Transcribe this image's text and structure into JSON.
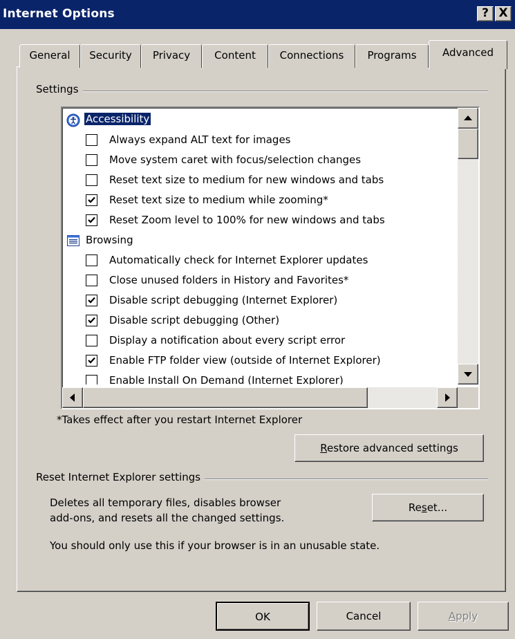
{
  "window": {
    "title": "Internet Options",
    "help_glyph": "?",
    "close_glyph": "X"
  },
  "tabs": [
    {
      "label": "General",
      "active": false
    },
    {
      "label": "Security",
      "active": false
    },
    {
      "label": "Privacy",
      "active": false
    },
    {
      "label": "Content",
      "active": false
    },
    {
      "label": "Connections",
      "active": false
    },
    {
      "label": "Programs",
      "active": false
    },
    {
      "label": "Advanced",
      "active": true
    }
  ],
  "settings": {
    "group_label": "Settings",
    "tree": [
      {
        "type": "header",
        "label": "Accessibility",
        "icon": "accessibility-icon",
        "selected": true
      },
      {
        "type": "checkbox",
        "label": "Always expand ALT text for images",
        "checked": false
      },
      {
        "type": "checkbox",
        "label": "Move system caret with focus/selection changes",
        "checked": false
      },
      {
        "type": "checkbox",
        "label": "Reset text size to medium for new windows and tabs",
        "checked": false
      },
      {
        "type": "checkbox",
        "label": "Reset text size to medium while zooming*",
        "checked": true
      },
      {
        "type": "checkbox",
        "label": "Reset Zoom level to 100% for new windows and tabs",
        "checked": true
      },
      {
        "type": "header",
        "label": "Browsing",
        "icon": "browsing-page-icon",
        "selected": false
      },
      {
        "type": "checkbox",
        "label": "Automatically check for Internet Explorer updates",
        "checked": false
      },
      {
        "type": "checkbox",
        "label": "Close unused folders in History and Favorites*",
        "checked": false
      },
      {
        "type": "checkbox",
        "label": "Disable script debugging (Internet Explorer)",
        "checked": true
      },
      {
        "type": "checkbox",
        "label": "Disable script debugging (Other)",
        "checked": true
      },
      {
        "type": "checkbox",
        "label": "Display a notification about every script error",
        "checked": false
      },
      {
        "type": "checkbox",
        "label": "Enable FTP folder view (outside of Internet Explorer)",
        "checked": true
      },
      {
        "type": "checkbox",
        "label": "Enable Install On Demand (Internet Explorer)",
        "checked": false
      }
    ],
    "restart_note": "*Takes effect after you restart Internet Explorer",
    "restore_button": {
      "before": "",
      "accel": "R",
      "after": "estore advanced settings"
    }
  },
  "reset": {
    "group_label": "Reset Internet Explorer settings",
    "description_line1": "Deletes all temporary files, disables browser",
    "description_line2": "add-ons, and resets all the changed settings.",
    "reset_button": {
      "before": "Re",
      "accel": "s",
      "after": "et..."
    },
    "warning": "You should only use this if your browser is in an unusable state."
  },
  "footer": {
    "ok_label": "OK",
    "cancel_label": "Cancel",
    "apply_button": {
      "before": "",
      "accel": "A",
      "after": "pply"
    }
  },
  "colors": {
    "face": "#d4d0c8",
    "titlebar": "#0a246a",
    "selection": "#0a246a"
  }
}
